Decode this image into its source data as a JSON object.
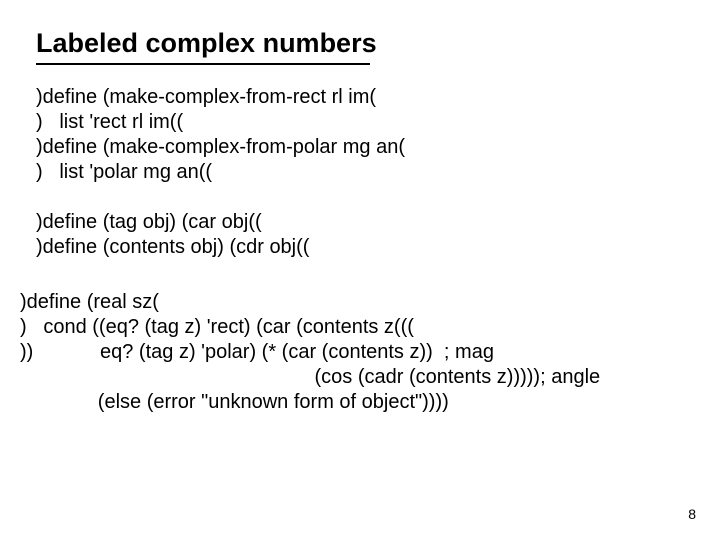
{
  "title": "Labeled complex numbers",
  "block1": {
    "line1": ")define (make-complex-from-rect rl im(",
    "line2": ")   list 'rect rl im((",
    "line3": ")define (make-complex-from-polar mg an(",
    "line4": ")   list 'polar mg an(("
  },
  "block2": {
    "line1": ")define (tag obj) (car obj((",
    "line2": ")define (contents obj) (cdr obj(("
  },
  "block3": {
    "line1": ")define (real sz(",
    "line2": ")   cond ((eq? (tag z) 'rect) (car (contents z(((",
    "line3": "))            eq? (tag z) 'polar) (* (car (contents z))  ; mag",
    "line4": "                                                     (cos (cadr (contents z))))); angle",
    "line5": "              (else (error \"unknown form of object\"))))"
  },
  "pagenum": "8"
}
